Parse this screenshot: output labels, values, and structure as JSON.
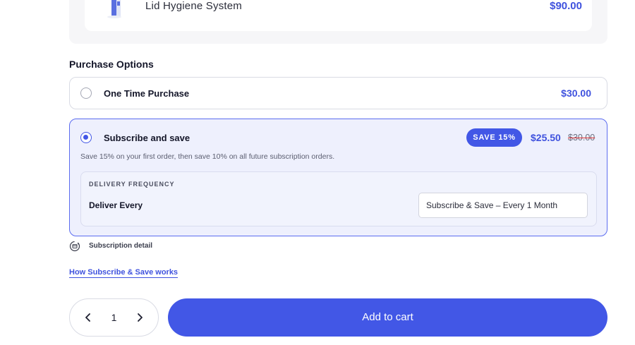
{
  "product": {
    "name": "Lid Hygiene System",
    "price": "$90.00"
  },
  "purchase_options": {
    "title": "Purchase Options",
    "one_time": {
      "label": "One Time Purchase",
      "price": "$30.00",
      "selected": false
    },
    "subscribe": {
      "label": "Subscribe and save",
      "badge": "SAVE 15%",
      "price": "$25.50",
      "original_price": "$30.00",
      "description": "Save 15% on your first order, then save 10% on all future subscription orders.",
      "selected": true,
      "delivery": {
        "heading": "DELIVERY FREQUENCY",
        "label": "Deliver Every",
        "selected_option": "Subscribe & Save – Every 1 Month"
      }
    }
  },
  "subscription_detail": {
    "label": "Subscription detail",
    "icon": "subscription-cycle-icon"
  },
  "how_link": "How Subscribe & Save works",
  "quantity": {
    "value": "1"
  },
  "add_to_cart": "Add to cart",
  "colors": {
    "accent": "#4257e6",
    "selected_bg": "#eef0fd",
    "strike": "#e03434"
  }
}
